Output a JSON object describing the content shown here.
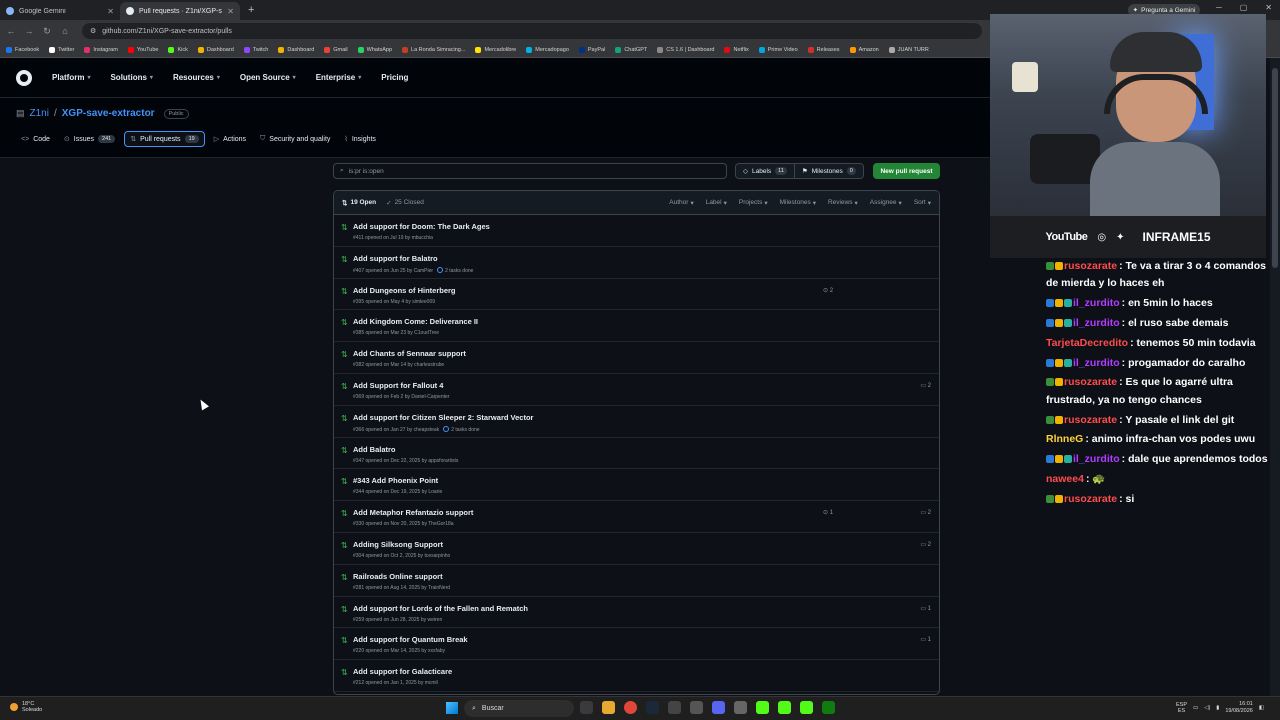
{
  "browser": {
    "tabs": [
      {
        "title": "Google Gemini",
        "active": false
      },
      {
        "title": "Pull requests · Z1ni/XGP-save-...",
        "active": true
      }
    ],
    "gemini_button": "Pregunta a Gemini",
    "url": "github.com/Z1ni/XGP-save-extractor/pulls",
    "bookmarks": [
      "Facebook",
      "Twitter",
      "Instagram",
      "YouTube",
      "Kick",
      "Dashboard",
      "Twitch",
      "Dashboard",
      "Gmail",
      "WhatsApp",
      "La Ronda Simracing...",
      "Mercadolibre",
      "Mercadopago",
      "PayPal",
      "ChatGPT",
      "CS 1.6 | Dashboard",
      "Netflix",
      "Prime Video",
      "Releases",
      "Amazon",
      "JUAN TURR"
    ]
  },
  "github": {
    "nav": [
      {
        "label": "Platform",
        "caret": true
      },
      {
        "label": "Solutions",
        "caret": true
      },
      {
        "label": "Resources",
        "caret": true
      },
      {
        "label": "Open Source",
        "caret": true
      },
      {
        "label": "Enterprise",
        "caret": true
      },
      {
        "label": "Pricing",
        "caret": false
      }
    ],
    "repo": {
      "owner": "Z1ni",
      "separator": "/",
      "name": "XGP-save-extractor",
      "visibility": "Public"
    },
    "tabs": [
      {
        "label": "Code",
        "count": null,
        "icon": "code-icon"
      },
      {
        "label": "Issues",
        "count": "241",
        "icon": "issue-icon"
      },
      {
        "label": "Pull requests",
        "count": "19",
        "icon": "pr-icon",
        "active": true
      },
      {
        "label": "Actions",
        "count": null,
        "icon": "play-icon"
      },
      {
        "label": "Security and quality",
        "count": null,
        "icon": "shield-icon"
      },
      {
        "label": "Insights",
        "count": null,
        "icon": "graph-icon"
      }
    ],
    "search": {
      "value": "is:pr is:open"
    },
    "labels_button": {
      "label": "Labels",
      "count": "11"
    },
    "milestones_button": {
      "label": "Milestones",
      "count": "0"
    },
    "new_pr_button": "New pull request",
    "list_header": {
      "open": "19 Open",
      "closed": "25 Closed",
      "filters": [
        "Author",
        "Label",
        "Projects",
        "Milestones",
        "Reviews",
        "Assignee",
        "Sort"
      ]
    },
    "prs": [
      {
        "title": "Add support for Doom: The Dark Ages",
        "meta": "#411 opened on Jul 19 by mbucchia",
        "tasks": "",
        "linked": "",
        "comments": ""
      },
      {
        "title": "Add support for Balatro",
        "meta": "#407 opened on Jun 25 by CamPier",
        "tasks": "2 tasks done",
        "linked": "",
        "comments": ""
      },
      {
        "title": "Add Dungeons of Hinterberg",
        "meta": "#395 opened on May 4 by simlee009",
        "tasks": "",
        "linked": "2",
        "comments": ""
      },
      {
        "title": "Add Kingdom Come: Deliverance II",
        "meta": "#385 opened on Mar 23 by C1oudTree",
        "tasks": "",
        "linked": "",
        "comments": ""
      },
      {
        "title": "Add Chants of Sennaar support",
        "meta": "#382 opened on Mar 14 by charlesstrube",
        "tasks": "",
        "linked": "",
        "comments": ""
      },
      {
        "title": "Add Support for Fallout 4",
        "meta": "#369 opened on Feb 2 by Daniel-Carpenter",
        "tasks": "",
        "linked": "",
        "comments": "2"
      },
      {
        "title": "Add support for Citizen Sleeper 2: Starward Vector",
        "meta": "#366 opened on Jan 27 by cheapsteak",
        "tasks": "2 tasks done",
        "linked": "",
        "comments": ""
      },
      {
        "title": "Add Balatro",
        "meta": "#347 opened on Dec 22, 2025 by appsforartists",
        "tasks": "",
        "linked": "",
        "comments": ""
      },
      {
        "title": "#343 Add Phoenix Point",
        "meta": "#344 opened on Dec 19, 2025 by Loarie",
        "tasks": "",
        "linked": "",
        "comments": ""
      },
      {
        "title": "Add Metaphor Refantazio support",
        "meta": "#330 opened on Nov 20, 2025 by TheGor18a",
        "tasks": "",
        "linked": "1",
        "comments": "2"
      },
      {
        "title": "Adding Silksong Support",
        "meta": "#304 opened on Oct 2, 2025 by tcesarpinho",
        "tasks": "",
        "linked": "",
        "comments": "2"
      },
      {
        "title": "Railroads Online support",
        "meta": "#281 opened on Aug 14, 2025 by TrainNerd",
        "tasks": "",
        "linked": "",
        "comments": ""
      },
      {
        "title": "Add support for Lords of the Fallen and Rematch",
        "meta": "#259 opened on Jun 28, 2025 by weiren",
        "tasks": "",
        "linked": "",
        "comments": "1"
      },
      {
        "title": "Add support for Quantum Break",
        "meta": "#220 opened on Mar 14, 2025 by xxxfaby",
        "tasks": "",
        "linked": "",
        "comments": "1"
      },
      {
        "title": "Add support for Galacticare",
        "meta": "#212 opened on Jan 1, 2025 by mcmil",
        "tasks": "",
        "linked": "",
        "comments": ""
      }
    ]
  },
  "stream": {
    "socials": {
      "youtube": "YouTube",
      "brand": "INFRAME15"
    },
    "chat": [
      {
        "user": "rusozarate",
        "color": "#ff4c4c",
        "text": ": Te va a tirar 3 o 4 comandos de mierda y lo haces eh",
        "badges": [
          "#3a8f3a",
          "#f0b400"
        ]
      },
      {
        "user": "il_zurdito",
        "color": "#b23cff",
        "text": ": en 5min lo haces",
        "badges": [
          "#2a7bd8",
          "#f0b400",
          "#2ab0a0"
        ]
      },
      {
        "user": "il_zurdito",
        "color": "#b23cff",
        "text": ": el ruso sabe demais",
        "badges": [
          "#2a7bd8",
          "#f0b400",
          "#2ab0a0"
        ]
      },
      {
        "user": "TarjetaDecredito",
        "color": "#ff4c4c",
        "text": ": tenemos 50 min todavia",
        "badges": []
      },
      {
        "user": "il_zurdito",
        "color": "#b23cff",
        "text": ": progamador do caralho",
        "badges": [
          "#2a7bd8",
          "#f0b400",
          "#2ab0a0"
        ]
      },
      {
        "user": "rusozarate",
        "color": "#ff4c4c",
        "text": ": Es que lo agarré ultra frustrado, ya no tengo chances",
        "badges": [
          "#3a8f3a",
          "#f0b400"
        ]
      },
      {
        "user": "rusozarate",
        "color": "#ff4c4c",
        "text": ": Y pasale el link del git",
        "badges": [
          "#3a8f3a",
          "#f0b400"
        ]
      },
      {
        "user": "RlnneG",
        "color": "#ffd23c",
        "text": ": animo infra-chan vos podes uwu",
        "badges": []
      },
      {
        "user": "il_zurdito",
        "color": "#b23cff",
        "text": ": dale que aprendemos todos",
        "badges": [
          "#2a7bd8",
          "#f0b400",
          "#2ab0a0"
        ]
      },
      {
        "user": "nawee4",
        "color": "#ff4c4c",
        "text": ": 🐢",
        "badges": []
      },
      {
        "user": "rusozarate",
        "color": "#ff4c4c",
        "text": ": si",
        "badges": [
          "#3a8f3a",
          "#f0b400"
        ]
      }
    ]
  },
  "taskbar": {
    "weather_temp": "18°C",
    "weather_desc": "Soleado",
    "search_label": "Buscar",
    "lang_top": "ESP",
    "lang_bottom": "ES",
    "time": "16:01",
    "date": "19/08/2026"
  }
}
